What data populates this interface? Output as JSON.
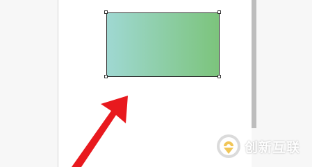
{
  "canvas": {
    "background_color": "#f7f7f7",
    "page_color": "#ffffff"
  },
  "selected_shape": {
    "type": "rectangle",
    "fill_gradient_start": "#9fd8d2",
    "fill_gradient_end": "#7cc47c",
    "border_color": "#2c2c2c",
    "selected": true
  },
  "annotation_arrow": {
    "icon": "red-arrow-icon",
    "color": "#e8191e"
  },
  "watermark": {
    "icon": "brand-logo-icon",
    "text": "创新互联"
  }
}
